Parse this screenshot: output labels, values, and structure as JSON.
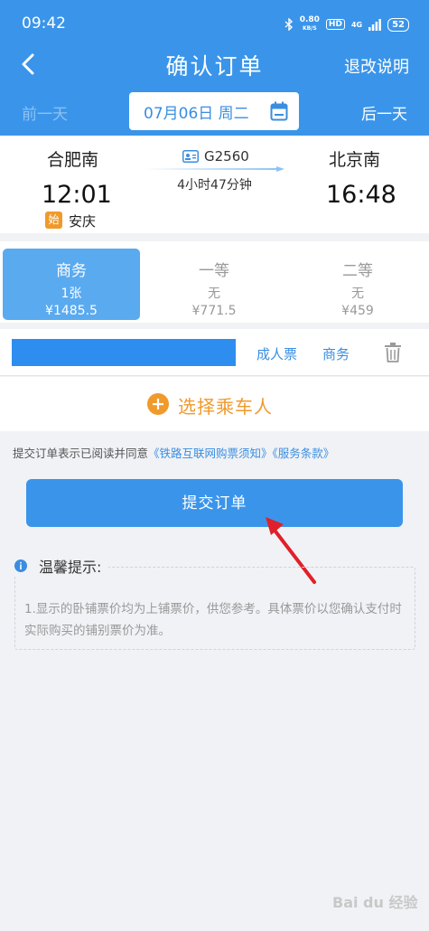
{
  "status_bar": {
    "time": "09:42",
    "speed_value": "0.80",
    "speed_unit": "KB/S",
    "hd": "HD",
    "network": "4G",
    "battery": "52"
  },
  "nav": {
    "title": "确认订单",
    "right_link": "退改说明"
  },
  "date_bar": {
    "prev": "前一天",
    "date": "07月06日 周二",
    "next": "后一天"
  },
  "train": {
    "from_station": "合肥南",
    "to_station": "北京南",
    "depart_time": "12:01",
    "arrive_time": "16:48",
    "train_no": "G2560",
    "duration": "4小时47分钟",
    "start_badge": "始",
    "via_city": "安庆"
  },
  "seats": [
    {
      "name": "商务",
      "count": "1张",
      "price": "¥1485.5",
      "active": true
    },
    {
      "name": "一等",
      "count": "无",
      "price": "¥771.5",
      "active": false
    },
    {
      "name": "二等",
      "count": "无",
      "price": "¥459",
      "active": false
    }
  ],
  "passenger": {
    "ticket_type": "成人票",
    "seat_class": "商务"
  },
  "add_passenger": {
    "label": "选择乘车人"
  },
  "agreement": {
    "prefix": "提交订单表示已阅读并同意",
    "link1": "《铁路互联网购票须知》",
    "link2": "《服务条款》"
  },
  "submit": {
    "label": "提交订单"
  },
  "tips": {
    "title": "温馨提示:",
    "body": "1.显示的卧铺票价均为上铺票价，供您参考。具体票价以您确认支付时实际购买的铺别票价为准。"
  },
  "watermark": "Bai du 经验",
  "colors": {
    "primary": "#3a95ea",
    "accent_orange": "#f09a2c",
    "arrow_red": "#e0202a"
  }
}
